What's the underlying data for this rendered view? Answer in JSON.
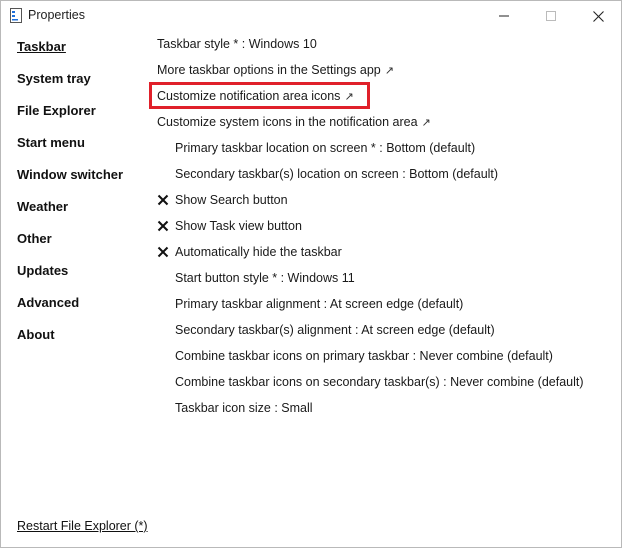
{
  "window": {
    "title": "Properties"
  },
  "sidebar": {
    "items": [
      {
        "label": "Taskbar",
        "active": true
      },
      {
        "label": "System tray"
      },
      {
        "label": "File Explorer"
      },
      {
        "label": "Start menu"
      },
      {
        "label": "Window switcher"
      },
      {
        "label": "Weather"
      },
      {
        "label": "Other"
      },
      {
        "label": "Updates"
      },
      {
        "label": "Advanced"
      },
      {
        "label": "About"
      }
    ]
  },
  "taskbar": {
    "taskbar_style": "Taskbar style * : Windows 10",
    "more_options": "More taskbar options in the Settings app",
    "customize_notification_icons": "Customize notification area icons",
    "customize_system_icons": "Customize system icons in the notification area",
    "primary_location": "Primary taskbar location on screen * : Bottom (default)",
    "secondary_location": "Secondary taskbar(s) location on screen : Bottom (default)",
    "show_search": "Show Search button",
    "show_task_view": "Show Task view button",
    "auto_hide": "Automatically hide the taskbar",
    "start_button_style": "Start button style * : Windows 11",
    "primary_alignment": "Primary taskbar alignment : At screen edge (default)",
    "secondary_alignment": "Secondary taskbar(s) alignment : At screen edge (default)",
    "combine_primary": "Combine taskbar icons on primary taskbar : Never combine (default)",
    "combine_secondary": "Combine taskbar icons on secondary taskbar(s) : Never combine (default)",
    "icon_size": "Taskbar icon size : Small",
    "external_link_glyph": "↗"
  },
  "footer": {
    "restart_label": "Restart File Explorer (*)"
  },
  "colors": {
    "highlight": "#e0202a"
  },
  "icons": [
    "app-icon",
    "minimize-icon",
    "maximize-icon",
    "close-icon",
    "checkmark-icon",
    "external-link-icon"
  ]
}
